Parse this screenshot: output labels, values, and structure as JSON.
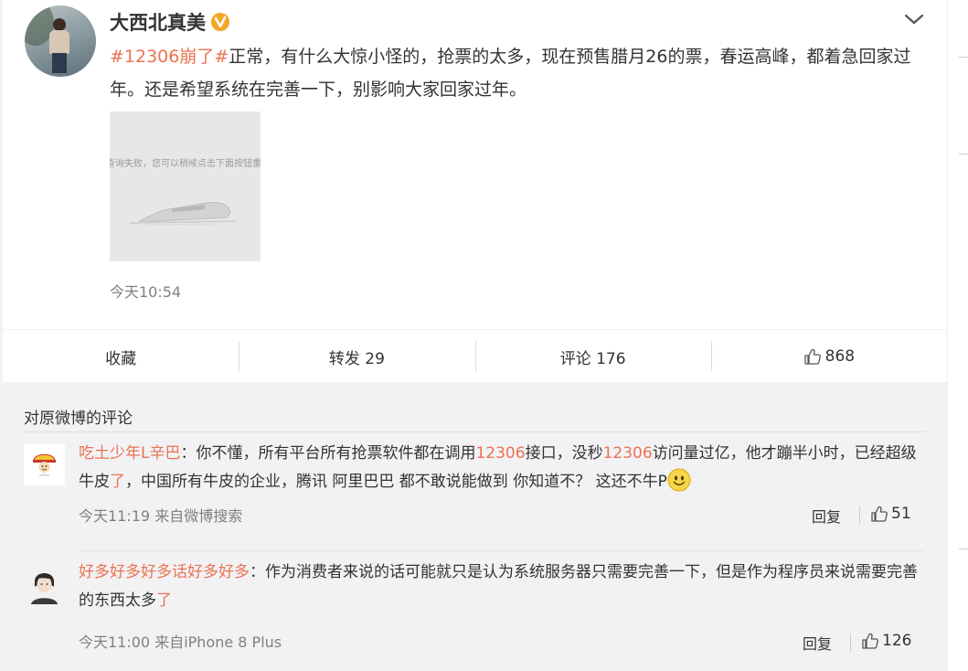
{
  "post": {
    "username": "大西北真美",
    "text_parts": [
      {
        "kind": "hashtag",
        "text": "#12306崩了#"
      },
      {
        "kind": "text",
        "text": "正常，有什么大惊小怪的，抢票的太多，现在预售腊月26的票，春运高峰，都着急回家过年。还是希望系统在完善一下，别影响大家回家过年。"
      }
    ],
    "image_caption": "查询失败，您可以稍候点击下面按钮重",
    "time": "今天10:54",
    "actions": {
      "favorite": "收藏",
      "repost": "转发 29",
      "comment": "评论 176",
      "like": "868"
    }
  },
  "comments_section": {
    "title": "对原微博的评论",
    "comments": [
      {
        "user": "吃土少年L辛巴",
        "text_parts": [
          {
            "kind": "text",
            "text": "：你不懂，所有平台所有抢票软件都在调用"
          },
          {
            "kind": "hl",
            "text": "12306"
          },
          {
            "kind": "text",
            "text": "接口，没秒"
          },
          {
            "kind": "hl",
            "text": "12306"
          },
          {
            "kind": "text",
            "text": "访问量过亿，他才蹦半小时，已经超级牛皮"
          },
          {
            "kind": "hl",
            "text": "了"
          },
          {
            "kind": "text",
            "text": "，中国所有牛皮的企业，腾讯 阿里巴巴 都不敢说能做到 你知道不？ 这还不牛P"
          }
        ],
        "meta": "今天11:19 来自微博搜索",
        "reply": "回复",
        "likes": "51"
      },
      {
        "user": "好多好多好多话好多好多",
        "text_parts": [
          {
            "kind": "text",
            "text": "：作为消费者来说的话可能就只是认为系统服务器只需要完善一下，但是作为程序员来说需要完善的东西太多"
          },
          {
            "kind": "hl",
            "text": "了"
          }
        ],
        "meta": "今天11:00 来自iPhone 8 Plus",
        "reply": "回复",
        "likes": "126"
      }
    ]
  },
  "colors": {
    "accent": "#eb7350",
    "verified": "#f5a623",
    "background": "#f2f2f5"
  },
  "icons": {
    "verified": "verified-icon",
    "more": "chevron-down-icon",
    "like": "thumbs-up-icon",
    "emoji": "smile-emoji-icon"
  }
}
